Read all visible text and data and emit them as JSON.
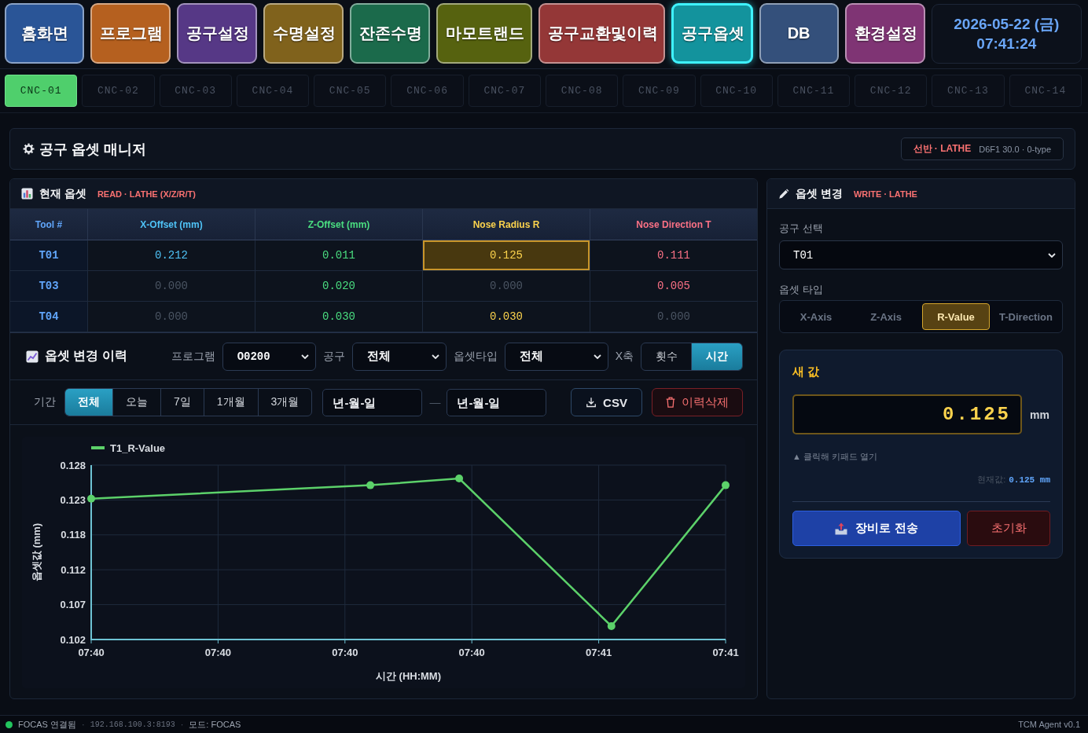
{
  "nav": {
    "items": [
      {
        "label": "홈화면",
        "color": "#2a5597",
        "selected": false
      },
      {
        "label": "프로그램",
        "color": "#b5601f",
        "selected": false
      },
      {
        "label": "공구설정",
        "color": "#563886",
        "selected": false
      },
      {
        "label": "수명설정",
        "color": "#80621c",
        "selected": false
      },
      {
        "label": "잔존수명",
        "color": "#1b6a4b",
        "selected": false
      },
      {
        "label": "마모트랜드",
        "color": "#56620f",
        "selected": false
      },
      {
        "label": "공구교환및이력",
        "color": "#943737",
        "selected": false
      },
      {
        "label": "공구옵셋",
        "color": "#13939d",
        "selected": true
      },
      {
        "label": "DB",
        "color": "#34507b",
        "selected": false
      },
      {
        "label": "환경설정",
        "color": "#7f3474",
        "selected": false
      }
    ],
    "clock": {
      "date": "2026-05-22 (금)",
      "time": "07:41:24"
    }
  },
  "machines": [
    {
      "label": "CNC-01",
      "selected": true
    },
    {
      "label": "CNC-02",
      "selected": false
    },
    {
      "label": "CNC-03",
      "selected": false
    },
    {
      "label": "CNC-04",
      "selected": false
    },
    {
      "label": "CNC-05",
      "selected": false
    },
    {
      "label": "CNC-06",
      "selected": false
    },
    {
      "label": "CNC-07",
      "selected": false
    },
    {
      "label": "CNC-08",
      "selected": false
    },
    {
      "label": "CNC-09",
      "selected": false
    },
    {
      "label": "CNC-10",
      "selected": false
    },
    {
      "label": "CNC-11",
      "selected": false
    },
    {
      "label": "CNC-12",
      "selected": false
    },
    {
      "label": "CNC-13",
      "selected": false
    },
    {
      "label": "CNC-14",
      "selected": false
    }
  ],
  "header": {
    "title": "공구 옵셋 매니저",
    "machine_type": "선반 · LATHE",
    "machine_model": "D6F1 30.0 · 0-type"
  },
  "current_offsets": {
    "title": "현재 옵셋",
    "mode": "READ · LATHE (X/Z/R/T)",
    "columns": [
      "Tool #",
      "X-Offset (mm)",
      "Z-Offset (mm)",
      "Nose Radius R",
      "Nose Direction T"
    ],
    "rows": [
      {
        "cells": [
          {
            "value": "T01",
            "dim": false,
            "selected": false
          },
          {
            "value": "0.212",
            "dim": false,
            "selected": false
          },
          {
            "value": "0.011",
            "dim": false,
            "selected": false
          },
          {
            "value": "0.125",
            "dim": false,
            "selected": true
          },
          {
            "value": "0.111",
            "dim": false,
            "selected": false
          }
        ]
      },
      {
        "cells": [
          {
            "value": "T03",
            "dim": false,
            "selected": false
          },
          {
            "value": "0.000",
            "dim": true,
            "selected": false
          },
          {
            "value": "0.020",
            "dim": false,
            "selected": false
          },
          {
            "value": "0.000",
            "dim": true,
            "selected": false
          },
          {
            "value": "0.005",
            "dim": false,
            "selected": false
          }
        ]
      },
      {
        "cells": [
          {
            "value": "T04",
            "dim": false,
            "selected": false
          },
          {
            "value": "0.000",
            "dim": true,
            "selected": false
          },
          {
            "value": "0.030",
            "dim": false,
            "selected": false
          },
          {
            "value": "0.030",
            "dim": false,
            "selected": false
          },
          {
            "value": "0.000",
            "dim": true,
            "selected": false
          }
        ]
      }
    ]
  },
  "history": {
    "title": "옵셋 변경 이력",
    "filters": [
      {
        "kind": "program",
        "label": "프로그램",
        "value": "O0200"
      },
      {
        "kind": "tool",
        "label": "공구",
        "value": "전체"
      },
      {
        "kind": "type",
        "label": "옵셋타입",
        "value": "전체"
      }
    ],
    "x_axis": {
      "label": "X축",
      "options": [
        {
          "label": "횟수",
          "selected": false
        },
        {
          "label": "시간",
          "selected": true
        }
      ]
    },
    "period": {
      "label": "기간",
      "options": [
        {
          "label": "전체",
          "selected": true
        },
        {
          "label": "오늘",
          "selected": false
        },
        {
          "label": "7일",
          "selected": false
        },
        {
          "label": "1개월",
          "selected": false
        },
        {
          "label": "3개월",
          "selected": false
        }
      ]
    },
    "date_from": {
      "placeholder": "년-월-일"
    },
    "date_separator": "—",
    "date_to": {
      "placeholder": "년-월-일"
    },
    "actions": [
      {
        "kind": "export",
        "label": "CSV"
      },
      {
        "kind": "delete",
        "label": "이력삭제"
      }
    ],
    "chart_data": {
      "type": "line",
      "grid": true,
      "xlabel": "시간 (HH:MM)",
      "ylabel": "옵셋값 (mm)",
      "categories": [
        "07:40",
        null,
        null,
        null,
        null,
        null,
        null,
        null,
        null,
        null,
        "07:40",
        null,
        null,
        null,
        null,
        null,
        null,
        null,
        null,
        null,
        "07:40",
        null,
        null,
        null,
        null,
        null,
        null,
        null,
        null,
        null,
        "07:40",
        null,
        null,
        null,
        null,
        null,
        null,
        null,
        null,
        null,
        "07:41",
        null,
        null,
        null,
        null,
        null,
        null,
        null,
        null,
        null,
        "07:41"
      ],
      "series": [
        {
          "name": "T1_R-Value",
          "color": "#5cd16a",
          "marker": "circle",
          "values": [
            0.123,
            null,
            null,
            null,
            null,
            null,
            null,
            null,
            null,
            null,
            null,
            null,
            null,
            null,
            null,
            null,
            null,
            null,
            null,
            null,
            null,
            null,
            0.125,
            null,
            null,
            null,
            null,
            null,
            null,
            0.126,
            null,
            null,
            null,
            null,
            null,
            null,
            null,
            null,
            null,
            null,
            null,
            0.104,
            null,
            null,
            null,
            null,
            null,
            null,
            null,
            null,
            0.125
          ]
        }
      ],
      "ylim": [
        0.102,
        0.128
      ],
      "yticks": [
        {
          "value": 0.102,
          "label": "0.102"
        },
        {
          "value": 0.1072,
          "label": "0.107"
        },
        {
          "value": 0.1124,
          "label": "0.112"
        },
        {
          "value": 0.1176,
          "label": "0.118"
        },
        {
          "value": 0.1228,
          "label": "0.123"
        },
        {
          "value": 0.128,
          "label": "0.128"
        }
      ]
    }
  },
  "editor": {
    "title": "옵셋 변경",
    "mode": "WRITE · LATHE",
    "tool_label": "공구 선택",
    "tool_value": "T01",
    "type_label": "옵셋 타입",
    "types": [
      {
        "label": "X-Axis",
        "selected": false
      },
      {
        "label": "Z-Axis",
        "selected": false
      },
      {
        "label": "R-Value",
        "selected": true
      },
      {
        "label": "T-Direction",
        "selected": false
      }
    ],
    "new_value": {
      "title": "새 값",
      "value": "0.125",
      "unit": "mm",
      "hint": "▲ 클릭해 키패드 열기",
      "current_label": "현재값:",
      "current_value": "0.125 mm"
    },
    "actions": [
      {
        "kind": "send",
        "label": "장비로 전송"
      },
      {
        "kind": "reset",
        "label": "초기화"
      }
    ]
  },
  "status_bar": {
    "items": [
      {
        "kind": "connection",
        "text": "FOCAS 연결됨",
        "connected": true
      },
      {
        "kind": "separator",
        "text": "·"
      },
      {
        "kind": "address",
        "text": "192.168.100.3:8193"
      },
      {
        "kind": "separator",
        "text": "·"
      },
      {
        "kind": "mode",
        "text": "모드: FOCAS"
      }
    ],
    "version": "TCM Agent v0.1"
  }
}
